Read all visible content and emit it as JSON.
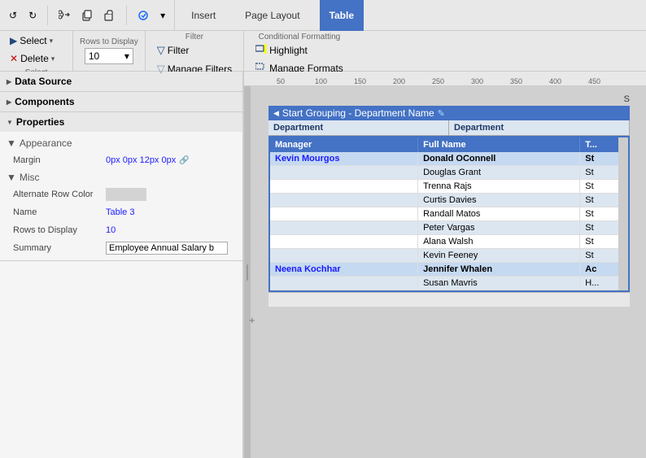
{
  "toolbar": {
    "undo_label": "↺",
    "redo_label": "↻",
    "cut_label": "✂",
    "copy_label": "⎘",
    "paste_label": "⬓",
    "insert_tab": "Insert",
    "page_layout_tab": "Page Layout",
    "table_tab": "Table"
  },
  "toolbar2": {
    "select_group_label": "Select",
    "select_btn": "Select",
    "delete_btn": "Delete",
    "rows_label": "Rows to Display",
    "rows_value": "10",
    "filter_label": "Filter",
    "filter_btn": "Filter",
    "manage_filters_btn": "Manage Filters",
    "cond_label": "Conditional Formatting",
    "highlight_btn": "Highlight",
    "manage_formats_btn": "Manage Formats"
  },
  "left_panel": {
    "data_source_label": "Data Source",
    "components_label": "Components",
    "properties_label": "Properties",
    "appearance_label": "Appearance",
    "margin_label": "Margin",
    "margin_value": "0px 0px 12px 0px",
    "misc_label": "Misc",
    "alt_row_color_label": "Alternate Row Color",
    "name_label": "Name",
    "name_value": "Table 3",
    "rows_to_display_label": "Rows to Display",
    "rows_to_display_value": "10",
    "summary_label": "Summary",
    "summary_value": "Employee Annual Salary b"
  },
  "ruler": {
    "marks": [
      "50",
      "100",
      "150",
      "200",
      "250",
      "300",
      "350",
      "400",
      "450"
    ]
  },
  "canvas": {
    "grouping_header": "Start Grouping - Department Name",
    "dept_col1": "Department",
    "dept_col2": "Department",
    "table_headers": [
      "Manager",
      "Full Name",
      "T..."
    ],
    "group1_manager": "Kevin Mourgos",
    "group1_rows": [
      {
        "full_name": "Donald OConnell",
        "col3": "St"
      },
      {
        "full_name": "Douglas Grant",
        "col3": "St"
      },
      {
        "full_name": "Trenna Rajs",
        "col3": "St"
      },
      {
        "full_name": "Curtis Davies",
        "col3": "St"
      },
      {
        "full_name": "Randall Matos",
        "col3": "St"
      },
      {
        "full_name": "Peter Vargas",
        "col3": "St"
      },
      {
        "full_name": "Alana Walsh",
        "col3": "St"
      },
      {
        "full_name": "Kevin Feeney",
        "col3": "St"
      }
    ],
    "group2_manager": "Neena Kochhar",
    "group2_rows": [
      {
        "full_name": "Jennifer Whalen",
        "col3": "Ac"
      },
      {
        "full_name": "Susan Mavris",
        "col3": "H..."
      }
    ]
  }
}
